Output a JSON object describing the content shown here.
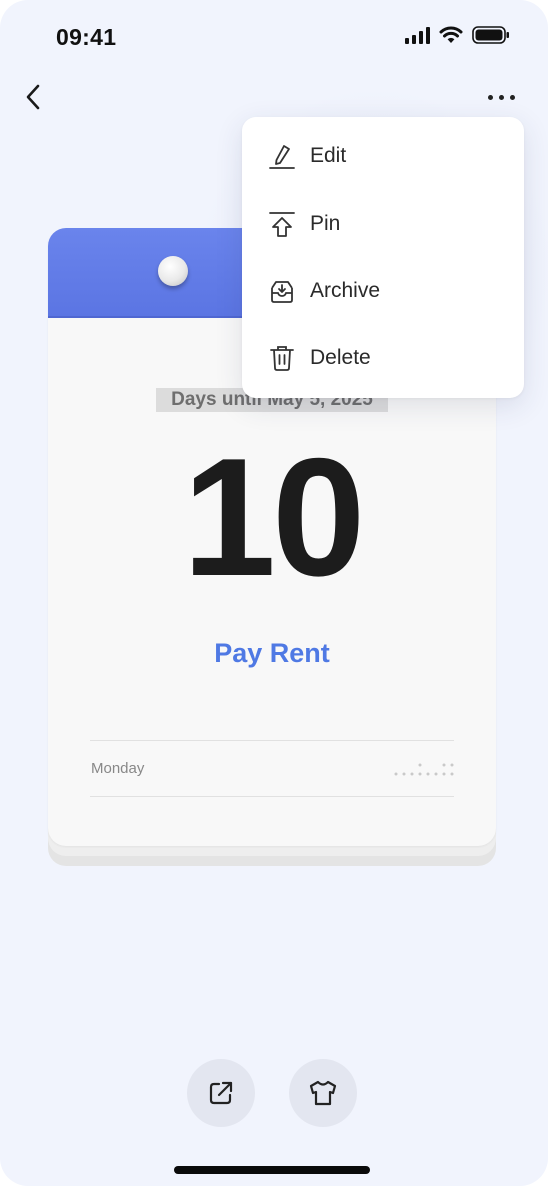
{
  "status_bar": {
    "time": "09:41"
  },
  "card": {
    "caption": "Days until May 5, 2025",
    "count": "10",
    "title": "Pay Rent",
    "weekday": "Monday"
  },
  "menu": {
    "items": [
      {
        "label": "Edit",
        "icon": "pencil-icon"
      },
      {
        "label": "Pin",
        "icon": "pin-up-arrow-icon"
      },
      {
        "label": "Archive",
        "icon": "archive-tray-icon"
      },
      {
        "label": "Delete",
        "icon": "trash-icon"
      }
    ]
  },
  "bottom_actions": [
    {
      "icon": "share-external-icon"
    },
    {
      "icon": "shirt-theme-icon"
    }
  ],
  "colors": {
    "background": "#f1f4fd",
    "accent": "#4f79e4",
    "header": "#5b75e3"
  }
}
